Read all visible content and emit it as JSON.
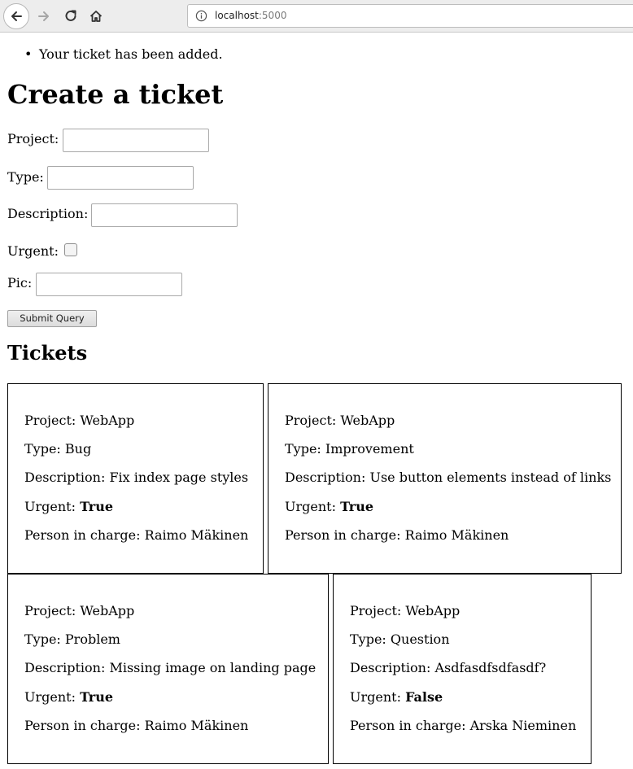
{
  "browser": {
    "url_host": "localhost",
    "url_port": ":5000",
    "icons": [
      "back-icon",
      "forward-icon",
      "reload-icon",
      "home-icon",
      "info-icon"
    ]
  },
  "flash": {
    "message": "Your ticket has been added."
  },
  "form": {
    "title": "Create a ticket",
    "project_label": "Project:",
    "type_label": "Type:",
    "description_label": "Description:",
    "urgent_label": "Urgent:",
    "pic_label": "Pic:",
    "submit_label": "Submit Query",
    "project_value": "",
    "type_value": "",
    "description_value": "",
    "pic_value": "",
    "urgent_checked": false
  },
  "tickets_heading": "Tickets",
  "ticket_labels": {
    "project": "Project:",
    "type": "Type:",
    "description": "Description:",
    "urgent": "Urgent:",
    "person": "Person in charge:"
  },
  "tickets": [
    {
      "project": "WebApp",
      "type": "Bug",
      "description": "Fix index page styles",
      "urgent": "True",
      "person": "Raimo Mäkinen"
    },
    {
      "project": "WebApp",
      "type": "Improvement",
      "description": "Use button elements instead of links",
      "urgent": "True",
      "person": "Raimo Mäkinen"
    },
    {
      "project": "WebApp",
      "type": "Problem",
      "description": "Missing image on landing page",
      "urgent": "True",
      "person": "Raimo Mäkinen"
    },
    {
      "project": "WebApp",
      "type": "Question",
      "description": "Asdfasdfsdfasdf?",
      "urgent": "False",
      "person": "Arska Nieminen"
    }
  ]
}
